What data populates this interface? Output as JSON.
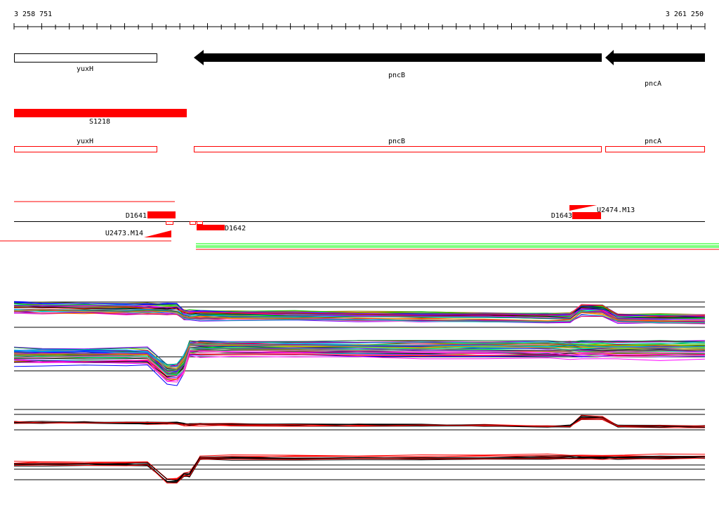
{
  "ruler": {
    "start_label": "3 258 751",
    "end_label": "3 261 250"
  },
  "genes": {
    "yuxH": "yuxH",
    "pncB": "pncB",
    "pncA": "pncA"
  },
  "segment_label": "S1218",
  "annotations": {
    "yuxH": "yuxH",
    "pncB": "pncB",
    "pncA": "pncA"
  },
  "features": {
    "d1641": "D1641",
    "d1642": "D1642",
    "d1643": "D1643",
    "u2473": "U2473.M14",
    "u2474": "U2474.M13"
  },
  "colors": {
    "accent": "#ff0000",
    "gene_fill": "#000000",
    "green_track": "#00ff00"
  }
}
